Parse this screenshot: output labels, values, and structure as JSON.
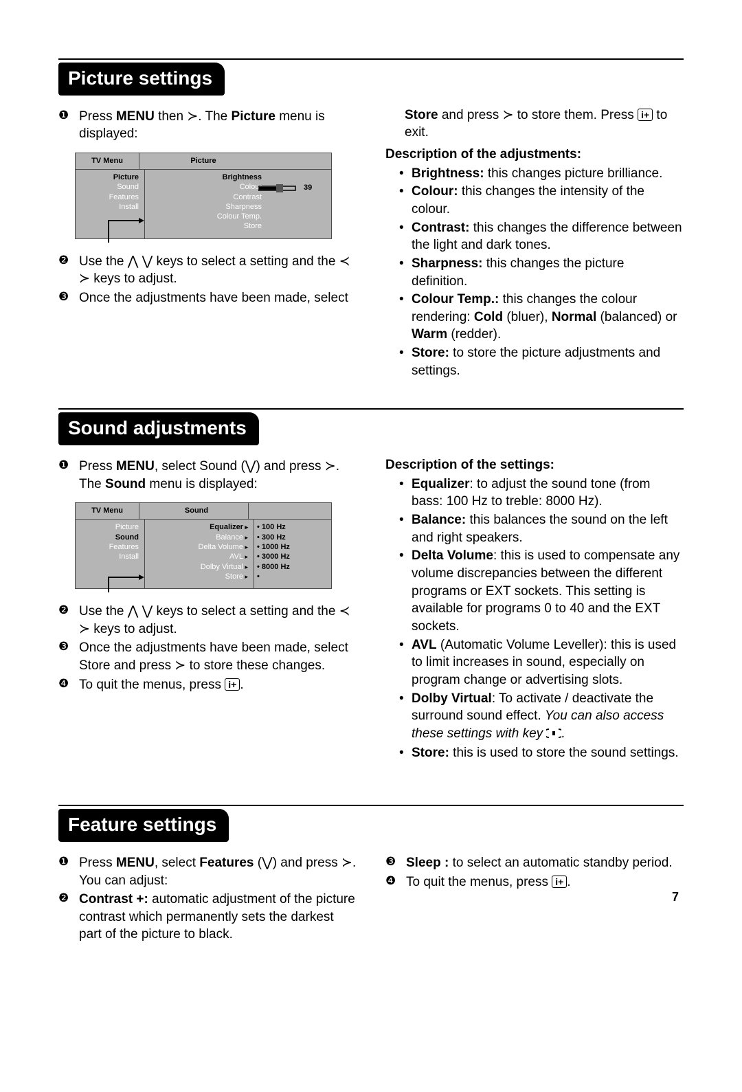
{
  "page_number": "7",
  "section1": {
    "title": "Picture settings",
    "step1_a": "Press ",
    "step1_menu": "MENU",
    "step1_b": " then ",
    "step1_c": ". The ",
    "step1_picture": "Picture",
    "step1_d": " menu is displayed:",
    "menu": {
      "tvmenu": "TV Menu",
      "header_right": "Picture",
      "side": {
        "i1": "Picture",
        "i2": "Sound",
        "i3": "Features",
        "i4": "Install"
      },
      "main": {
        "i1": "Brightness",
        "i2": "Colour",
        "i3": "Contrast",
        "i4": "Sharpness",
        "i5": "Colour Temp.",
        "i6": "Store"
      },
      "value": "39"
    },
    "step2_a": "Use the ",
    "step2_b": " keys to select a setting and the ",
    "step2_c": " keys to adjust.",
    "step3": "Once the adjustments have been made, select",
    "right_a1": "Store",
    "right_a2": " and press ",
    "right_a3": " to store them. Press ",
    "right_a4": " to exit.",
    "desc_head": "Description of the adjustments:",
    "bullets": {
      "b1_t": "Brightness:",
      "b1": " this changes picture brilliance.",
      "b2_t": "Colour:",
      "b2": " this changes the intensity of the colour.",
      "b3_t": "Contrast:",
      "b3": " this changes the difference between the light and dark tones.",
      "b4_t": "Sharpness:",
      "b4": " this changes the picture definition.",
      "b5_t": "Colour Temp.:",
      "b5a": " this changes the colour rendering: ",
      "b5b": "Cold",
      "b5c": " (bluer), ",
      "b5d": "Normal",
      "b5e": " (balanced) or ",
      "b5f": "Warm",
      "b5g": " (redder).",
      "b6_t": "Store:",
      "b6": " to store the picture adjustments and settings."
    }
  },
  "section2": {
    "title": "Sound adjustments",
    "step1_a": "Press ",
    "step1_menu": "MENU",
    "step1_b": ", select Sound (",
    "step1_c": ") and press ",
    "step1_d": ". The ",
    "step1_sound": "Sound",
    "step1_e": " menu is displayed:",
    "menu": {
      "tvmenu": "TV Menu",
      "header_right": "Sound",
      "side": {
        "i1": "Picture",
        "i2": "Sound",
        "i3": "Features",
        "i4": "Install"
      },
      "main": {
        "i1": "Equalizer",
        "i2": "Balance",
        "i3": "Delta Volume",
        "i4": "AVL",
        "i5": "Dolby Virtual",
        "i6": "Store"
      },
      "vals": {
        "v1": "100 Hz",
        "v2": "300 Hz",
        "v3": "1000 Hz",
        "v4": "3000 Hz",
        "v5": "8000 Hz"
      }
    },
    "step2_a": "Use the ",
    "step2_b": " keys to select a setting and the ",
    "step2_c": " keys to adjust.",
    "step3_a": "Once the adjustments have been made, select Store and press ",
    "step3_b": " to store these changes.",
    "step4_a": "To quit the menus, press ",
    "step4_b": ".",
    "desc_head": "Description of the settings:",
    "bullets": {
      "b1_t": "Equalizer",
      "b1": ": to adjust the sound tone (from bass: 100 Hz to treble: 8000 Hz).",
      "b2_t": "Balance:",
      "b2": " this balances the sound on the left and right speakers.",
      "b3_t": "Delta Volume",
      "b3": ": this is used to compensate any volume discrepancies between the different programs or EXT sockets. This setting is available for programs 0 to 40 and the EXT sockets.",
      "b4_t": "AVL",
      "b4": " (Automatic Volume Leveller): this is used to limit increases in sound, especially on program change or advertising slots.",
      "b5_t": "Dolby Virtual",
      "b5a": ": To activate / deactivate the surround sound effect. ",
      "b5b": "You can also access these settings with key ",
      "b5c": ".",
      "b6_t": "Store:",
      "b6": " this is used to store the sound settings."
    }
  },
  "section3": {
    "title": "Feature settings",
    "step1_a": "Press ",
    "step1_menu": "MENU",
    "step1_b": ", select ",
    "step1_feat": "Features",
    "step1_c": " (",
    "step1_d": ") and press ",
    "step1_e": ". You can adjust:",
    "step2_t": "Contrast +:",
    "step2": " automatic adjustment of the picture contrast which permanently sets the darkest part of the picture to black.",
    "step3_t": "Sleep :",
    "step3": " to select an automatic standby period.",
    "step4_a": "To quit the menus, press ",
    "step4_b": "."
  },
  "glyph": {
    "right": "≻",
    "up": "⋀",
    "down": "⋁",
    "left": "≺"
  }
}
